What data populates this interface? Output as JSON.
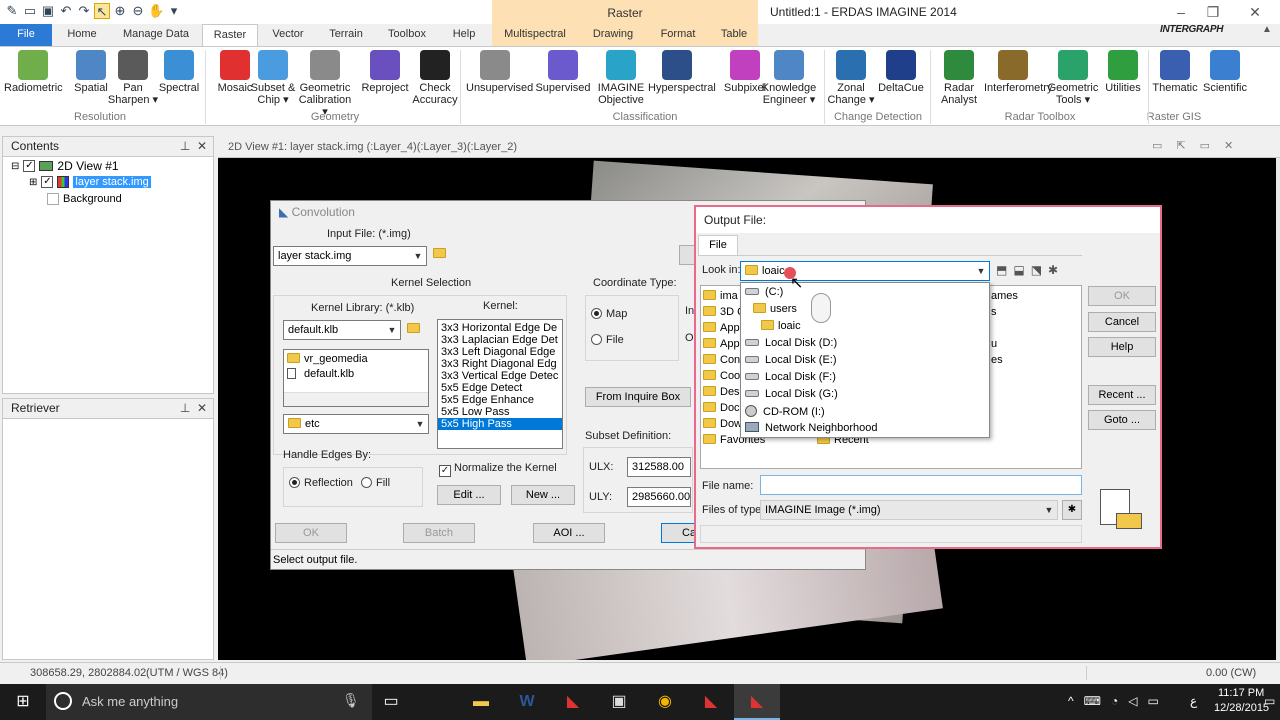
{
  "app": {
    "title": "Untitled:1 - ERDAS IMAGINE 2014",
    "context_tab_group": "Raster",
    "brand": "INTERGRAPH"
  },
  "tabs": [
    {
      "label": "File"
    },
    {
      "label": "Home"
    },
    {
      "label": "Manage Data"
    },
    {
      "label": "Raster"
    },
    {
      "label": "Vector"
    },
    {
      "label": "Terrain"
    },
    {
      "label": "Toolbox"
    },
    {
      "label": "Help"
    },
    {
      "label": "Multispectral"
    },
    {
      "label": "Drawing"
    },
    {
      "label": "Format"
    },
    {
      "label": "Table"
    }
  ],
  "ribbon": {
    "buttons": [
      {
        "label": "Radiometric",
        "color": "#6fae4a"
      },
      {
        "label": "Spatial",
        "color": "#4f86c6"
      },
      {
        "label": "Pan Sharpen ▾",
        "color": "#5a5a5a"
      },
      {
        "label": "Spectral",
        "color": "#3b8fd4"
      },
      {
        "label": "Mosaic",
        "color": "#e03030"
      },
      {
        "label": "Subset & Chip ▾",
        "color": "#4a9be0"
      },
      {
        "label": "Geometric Calibration ▾",
        "color": "#8a8a8a"
      },
      {
        "label": "Reproject",
        "color": "#6a4fbf"
      },
      {
        "label": "Check Accuracy",
        "color": "#222222"
      },
      {
        "label": "Unsupervised",
        "color": "#8a8a8a"
      },
      {
        "label": "Supervised",
        "color": "#6a5acd"
      },
      {
        "label": "IMAGINE Objective",
        "color": "#2aa3c8"
      },
      {
        "label": "Hyperspectral",
        "color": "#2c4f8a"
      },
      {
        "label": "Subpixel",
        "color": "#c040c0"
      },
      {
        "label": "Knowledge Engineer ▾",
        "color": "#4f86c6"
      },
      {
        "label": "Zonal Change ▾",
        "color": "#2a6fb0"
      },
      {
        "label": "DeltaCue",
        "color": "#1f3f8a"
      },
      {
        "label": "Radar Analyst",
        "color": "#2e8b3e"
      },
      {
        "label": "Interferometry",
        "color": "#8a6a2a"
      },
      {
        "label": "Geometric Tools ▾",
        "color": "#2aa36a"
      },
      {
        "label": "Utilities",
        "color": "#2e9e3e"
      },
      {
        "label": "Thematic",
        "color": "#3a5fb0"
      },
      {
        "label": "Scientific",
        "color": "#3a7fd0"
      }
    ],
    "groups": [
      "Resolution",
      "Geometry",
      "Classification",
      "Change Detection",
      "Radar Toolbox",
      "Raster GIS"
    ]
  },
  "contents": {
    "title": "Contents",
    "view": "2D View #1",
    "layer": "layer stack.img",
    "background": "Background"
  },
  "retriever": {
    "title": "Retriever"
  },
  "view": {
    "title": "2D View #1: layer stack.img (:Layer_4)(:Layer_3)(:Layer_2)"
  },
  "convolution": {
    "title": "Convolution",
    "input_label": "Input File: (*.img)",
    "input_value": "layer stack.img",
    "kernel_selection": "Kernel Selection",
    "library_label": "Kernel Library: (*.klb)",
    "library_value": "default.klb",
    "library_items": [
      "vr_geomedia",
      "default.klb"
    ],
    "dir_value": "etc",
    "kernel_label": "Kernel:",
    "kernels": [
      "3x3 Horizontal Edge De",
      "3x3 Laplacian Edge Det",
      "3x3 Left Diagonal Edge",
      "3x3 Right Diagonal Edg",
      "3x3 Vertical Edge Detec",
      "5x5 Edge Detect",
      "5x5 Edge Enhance",
      "5x5 Low Pass",
      "5x5 High Pass"
    ],
    "handle_edges": "Handle Edges By:",
    "reflection": "Reflection",
    "fill": "Fill",
    "normalize": "Normalize the Kernel",
    "edit": "Edit ...",
    "new": "New ...",
    "coord_type": "Coordinate Type:",
    "map": "Map",
    "file": "File",
    "inquire": "From Inquire Box",
    "subset_def": "Subset Definition:",
    "ulx_label": "ULX:",
    "ulx_value": "312588.00",
    "uly_label": "ULY:",
    "uly_value": "2985660.00",
    "ok": "OK",
    "batch": "Batch",
    "aoi": "AOI ...",
    "cancel_partial": "Ca",
    "status": "Select output file.",
    "trunc_in": "In",
    "trunc_ou": "Ou"
  },
  "output_file": {
    "title": "Output File:",
    "tab": "File",
    "look_in_label": "Look in:",
    "look_in_value": "loaic",
    "dropdown": [
      {
        "label": "(C:)",
        "type": "drive"
      },
      {
        "label": "users",
        "type": "folder"
      },
      {
        "label": "loaic",
        "type": "folder"
      },
      {
        "label": "Local Disk (D:)",
        "type": "drive"
      },
      {
        "label": "Local Disk (E:)",
        "type": "drive"
      },
      {
        "label": "Local Disk (F:)",
        "type": "drive"
      },
      {
        "label": "Local Disk (G:)",
        "type": "drive"
      },
      {
        "label": "CD-ROM (I:)",
        "type": "cd"
      },
      {
        "label": "Network Neighborhood",
        "type": "net"
      }
    ],
    "bg_items": [
      "ima",
      "3D C",
      "Appl",
      "Appl",
      "Cont",
      "Cook",
      "Desk",
      "Docu",
      "Dow",
      "Favorites"
    ],
    "bg_right": [
      "ames",
      "s",
      "u",
      "es"
    ],
    "recent": "Recent",
    "file_name_label": "File name:",
    "file_name_value": "",
    "files_type_label": "Files of type:",
    "files_type_value": "IMAGINE Image (*.img)",
    "ok": "OK",
    "cancel": "Cancel",
    "help": "Help",
    "recent_btn": "Recent ...",
    "goto": "Goto ..."
  },
  "statusbar": {
    "coords": "308658.29, 2802884.02",
    "proj": "(UTM / WGS 84)",
    "rotation": "0.00 (CW)"
  },
  "taskbar": {
    "search": "Ask me anything",
    "time": "11:17 PM",
    "date": "12/28/2015",
    "lang": "ع"
  }
}
